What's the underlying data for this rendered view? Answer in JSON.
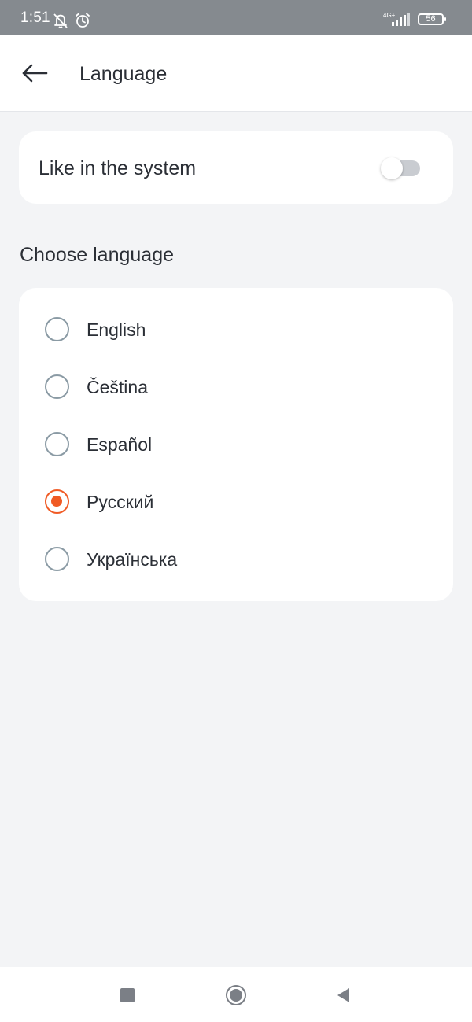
{
  "status_bar": {
    "time": "1:51",
    "network": "4G+",
    "battery": "56",
    "icons": [
      "bell-off-icon",
      "alarm-icon",
      "signal-icon",
      "battery-icon"
    ]
  },
  "app_bar": {
    "title": "Language",
    "back_icon": "arrow-left-icon"
  },
  "system_setting": {
    "label": "Like in the system",
    "toggle_on": false
  },
  "language_section": {
    "title": "Choose language",
    "selected": "Русский",
    "options": [
      {
        "label": "English",
        "checked": false
      },
      {
        "label": "Čeština",
        "checked": false
      },
      {
        "label": "Español",
        "checked": false
      },
      {
        "label": "Русский",
        "checked": true
      },
      {
        "label": "Українська",
        "checked": false
      }
    ]
  },
  "nav_bar": {
    "icons": [
      "recents-square-icon",
      "home-circle-icon",
      "back-triangle-icon"
    ]
  },
  "colors": {
    "accent": "#f05a24",
    "status_bar": "#858a8f",
    "background": "#f3f4f6",
    "card": "#ffffff",
    "text": "#2b2f36"
  }
}
